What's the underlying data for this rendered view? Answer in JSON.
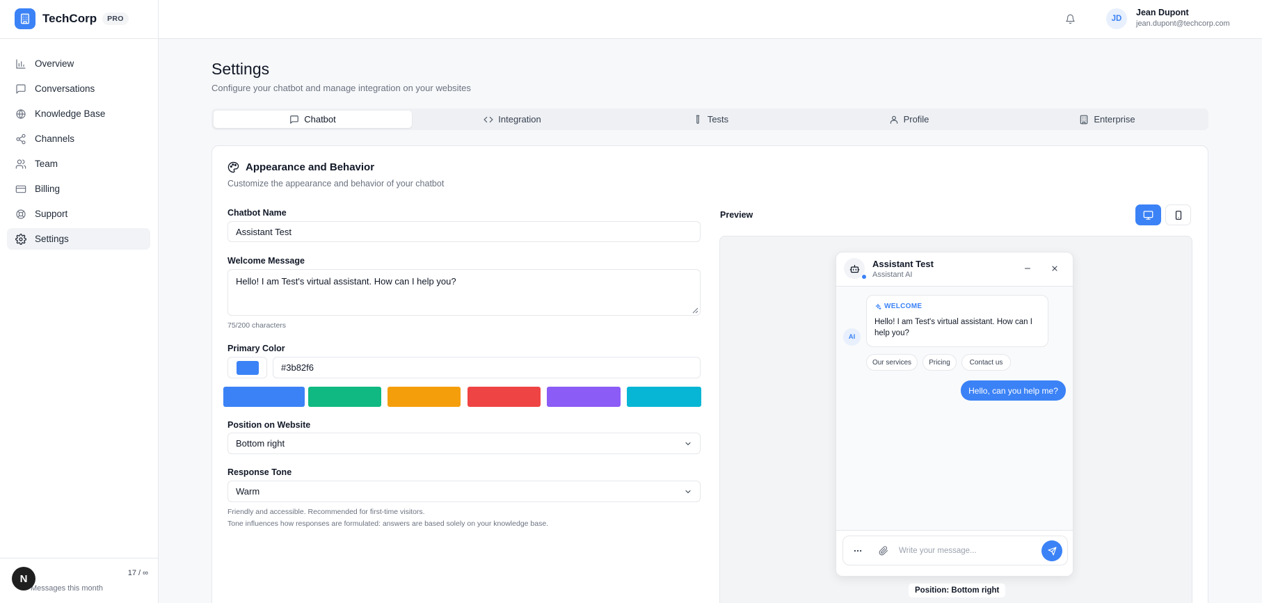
{
  "brand": {
    "name": "TechCorp",
    "badge": "PRO",
    "logo_icon": "building-icon"
  },
  "sidebar": {
    "items": [
      {
        "label": "Overview",
        "icon": "bar-chart-icon"
      },
      {
        "label": "Conversations",
        "icon": "message-square-icon"
      },
      {
        "label": "Knowledge Base",
        "icon": "globe-icon"
      },
      {
        "label": "Channels",
        "icon": "share-icon"
      },
      {
        "label": "Team",
        "icon": "users-icon"
      },
      {
        "label": "Billing",
        "icon": "credit-card-icon"
      },
      {
        "label": "Support",
        "icon": "lifebuoy-icon"
      },
      {
        "label": "Settings",
        "icon": "gear-icon",
        "active": true
      }
    ],
    "usage": {
      "count": "17 / ∞",
      "label": "Messages this month"
    },
    "avatar_letter": "N"
  },
  "header": {
    "user_initials": "JD",
    "user_name": "Jean Dupont",
    "user_email": "jean.dupont@techcorp.com"
  },
  "page": {
    "title": "Settings",
    "subtitle": "Configure your chatbot and manage integration on your websites"
  },
  "tabs": [
    {
      "label": "Chatbot",
      "icon": "message-square-icon",
      "active": true
    },
    {
      "label": "Integration",
      "icon": "code-icon"
    },
    {
      "label": "Tests",
      "icon": "test-tube-icon"
    },
    {
      "label": "Profile",
      "icon": "user-icon"
    },
    {
      "label": "Enterprise",
      "icon": "building-icon"
    }
  ],
  "section": {
    "title": "Appearance and Behavior",
    "subtitle": "Customize the appearance and behavior of your chatbot"
  },
  "form": {
    "name_label": "Chatbot Name",
    "name_value": "Assistant Test",
    "welcome_label": "Welcome Message",
    "welcome_value": "Hello! I am Test's virtual assistant. How can I help you?",
    "welcome_count": "75/200 characters",
    "color_label": "Primary Color",
    "color_value": "#3b82f6",
    "palette": [
      "#3b82f6",
      "#10b981",
      "#f59e0b",
      "#ef4444",
      "#8b5cf6",
      "#06b6d4"
    ],
    "position_label": "Position on Website",
    "position_value": "Bottom right",
    "tone_label": "Response Tone",
    "tone_value": "Warm",
    "tone_hint": "Friendly and accessible. Recommended for first-time visitors.",
    "tone_note": "Tone influences how responses are formulated: answers are based solely on your knowledge base."
  },
  "preview": {
    "label": "Preview",
    "chat_name": "Assistant Test",
    "chat_role": "Assistant AI",
    "welcome_tag": "WELCOME",
    "welcome_message": "Hello! I am Test's virtual assistant. How can I help you?",
    "ai_badge": "AI",
    "quick_replies": [
      "Our services",
      "Pricing",
      "Contact us"
    ],
    "user_message": "Hello, can you help me?",
    "input_placeholder": "Write your message...",
    "position_pill": "Position: Bottom right"
  },
  "colors": {
    "accent": "#3b82f6",
    "text": "#111827",
    "muted": "#6b7280",
    "border": "#e5e7eb"
  }
}
